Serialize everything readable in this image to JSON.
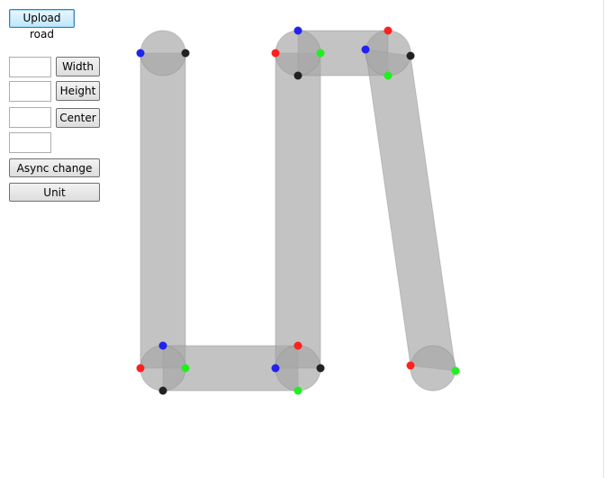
{
  "toolbar": {
    "upload_road_label": "Upload road",
    "width_label": "Width",
    "height_label": "Height",
    "center_label": "Center",
    "async_change_label": "Async change",
    "unit_label": "Unit",
    "width_value": "",
    "height_value": "",
    "center_value": "",
    "extra_value": ""
  },
  "colors": {
    "road": "#a6a6a6",
    "road_stroke": "#8a8a8a",
    "marker_red": "#ff2020",
    "marker_green": "#22ee22",
    "marker_blue": "#2222ee",
    "marker_black": "#222222"
  }
}
